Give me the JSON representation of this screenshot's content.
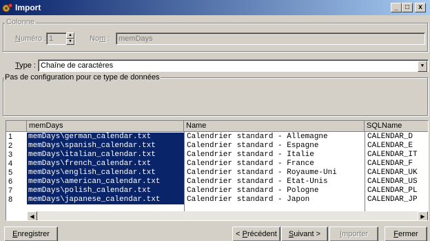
{
  "window": {
    "title": "Import",
    "minimize": "_",
    "maximize": "□",
    "close": "x"
  },
  "colonne": {
    "legend": "Colonne",
    "numero_label_u": "N",
    "numero_label_rest": "uméro :",
    "numero_value": "1",
    "nom_label_a": "No",
    "nom_label_u": "m",
    "nom_label_rest": " :",
    "nom_value": "memDays"
  },
  "type": {
    "label_u": "T",
    "label_rest": "ype :",
    "value": "Chaîne de caractères"
  },
  "config": {
    "legend": "Pas de configuration pour ce type de données"
  },
  "grid": {
    "headers": [
      "memDays",
      "Name",
      "SQLName"
    ],
    "rows": [
      {
        "num": "1",
        "memDays": "memDays\\german_calendar.txt",
        "name": "Calendrier standard - Allemagne",
        "sql": "CALENDAR_D"
      },
      {
        "num": "2",
        "memDays": "memDays\\spanish_calendar.txt",
        "name": "Calendrier standard - Espagne",
        "sql": "CALENDAR_E"
      },
      {
        "num": "3",
        "memDays": "memDays\\italian_calendar.txt",
        "name": "Calendrier standard - Italie",
        "sql": "CALENDAR_IT"
      },
      {
        "num": "4",
        "memDays": "memDays\\french_calendar.txt",
        "name": "Calendrier standard - France",
        "sql": "CALENDAR_F"
      },
      {
        "num": "5",
        "memDays": "memDays\\english_calendar.txt",
        "name": "Calendrier standard - Royaume-Uni",
        "sql": "CALENDAR_UK"
      },
      {
        "num": "6",
        "memDays": "memDays\\american_calendar.txt",
        "name": "Calendrier standard - Etat-Unis",
        "sql": "CALENDAR_US"
      },
      {
        "num": "7",
        "memDays": "memDays\\polish_calendar.txt",
        "name": "Calendrier standard - Pologne",
        "sql": "CALENDAR_PL"
      },
      {
        "num": "8",
        "memDays": "memDays\\japanese_calendar.txt",
        "name": "Calendrier standard - Japon",
        "sql": "CALENDAR_JP"
      }
    ]
  },
  "buttons": {
    "enregistrer_u": "E",
    "enregistrer_rest": "nregistrer",
    "precedent_a": "< ",
    "precedent_u": "P",
    "precedent_rest": "récédent",
    "suivant_u": "S",
    "suivant_rest": "uivant >",
    "importer_u": "I",
    "importer_rest": "mporter",
    "fermer_u": "F",
    "fermer_rest": "ermer"
  },
  "colors": {
    "title_bar": "#0a246a",
    "face": "#d4d0c8",
    "selection": "#0a246a"
  },
  "icons": {
    "app": "import-gear-icon",
    "left_arrow": "◀",
    "right_arrow": "▶",
    "combo": "▼",
    "spin_up": "▲",
    "spin_down": "▼"
  }
}
